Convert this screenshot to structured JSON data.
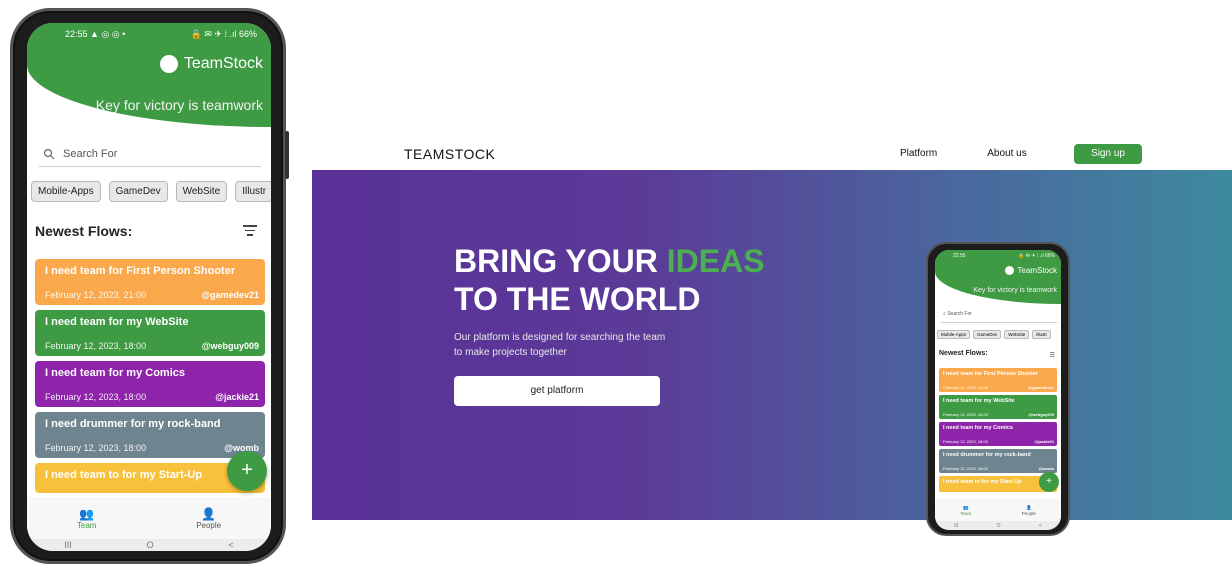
{
  "app": {
    "status_time": "22:55",
    "status_left_icons": "▲ ◎ ◎ •",
    "status_right": "🔒 ✉ ✈ ⁞ .ıl 66%",
    "brand": "TeamStock",
    "motto": "Key for victory is teamwork",
    "search_placeholder": "Search For",
    "chips": [
      "Mobile-Apps",
      "GameDev",
      "WebSite",
      "Illustr"
    ],
    "newest_label": "Newest Flows:",
    "flows": [
      {
        "title": "I need team for First Person Shooter",
        "date": "February 12, 2023, 21:00",
        "user": "@gamedev21",
        "color": "#f9a94b"
      },
      {
        "title": "I need team for my WebSite",
        "date": "February 12, 2023, 18:00",
        "user": "@webguy009",
        "color": "#3e9a43"
      },
      {
        "title": "I need team for my Comics",
        "date": "February 12, 2023, 18:00",
        "user": "@jackie21",
        "color": "#8e24aa"
      },
      {
        "title": "I need drummer for my rock-band",
        "date": "February 12, 2023, 18:00",
        "user": "@womb",
        "color": "#6e8590"
      },
      {
        "title": "I need team to for my Start-Up",
        "date": "",
        "user": "",
        "color": "#f7c13b"
      }
    ],
    "fab": "+",
    "nav_team": "Team",
    "nav_people": "People",
    "sys_nav": [
      "III",
      "O",
      "<"
    ]
  },
  "site": {
    "logo": "TEAMSTOCK",
    "nav": [
      "Platform",
      "About us"
    ],
    "signup": "Sign up",
    "hero_line1_a": "BRING YOUR ",
    "hero_line1_b": "IDEAS",
    "hero_line2": "TO THE WORLD",
    "hero_sub_1": "Our platform is designed for searching the team",
    "hero_sub_2": "to make projects together",
    "cta": "get platform"
  },
  "colors": {
    "brand_green": "#3e9a43",
    "hero_start": "#5a3197",
    "hero_end": "#3d8a9e"
  }
}
